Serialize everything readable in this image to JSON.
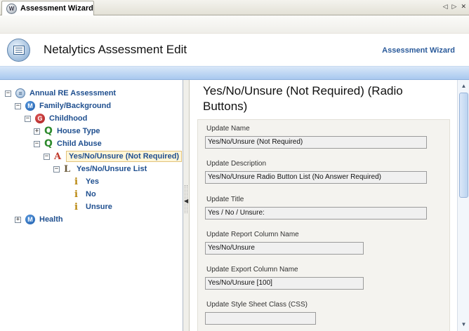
{
  "tab": {
    "icon_letter": "W",
    "label": "Assessment Wizard",
    "prev": "◁",
    "next": "▷",
    "close": "✕"
  },
  "header": {
    "title": "Netalytics Assessment Edit",
    "link": "Assessment Wizard"
  },
  "tree": {
    "root": "Annual RE Assessment",
    "family": "Family/Background",
    "childhood": "Childhood",
    "house_type": "House Type",
    "child_abuse": "Child Abuse",
    "selected_answer": "Yes/No/Unsure (Not Required)",
    "list": "Yes/No/Unsure List",
    "item_yes": "Yes",
    "item_no": "No",
    "item_unsure": "Unsure",
    "health": "Health",
    "icon_m": "M",
    "icon_g": "G"
  },
  "main": {
    "title": "Yes/No/Unsure (Not Required) (Radio Buttons)",
    "fields": {
      "name_label": "Update Name",
      "name_value": "Yes/No/Unsure (Not Required)",
      "desc_label": "Update Description",
      "desc_value": "Yes/No/Unsure Radio Button List (No Answer Required)",
      "title_label": "Update Title",
      "title_value": "Yes / No / Unsure:",
      "report_label": "Update Report Column Name",
      "report_value": "Yes/No/Unsure",
      "export_label": "Update Export Column Name",
      "export_value": "Yes/No/Unsure [100]",
      "css_label": "Update Style Sheet Class (CSS)",
      "css_value": ""
    }
  }
}
